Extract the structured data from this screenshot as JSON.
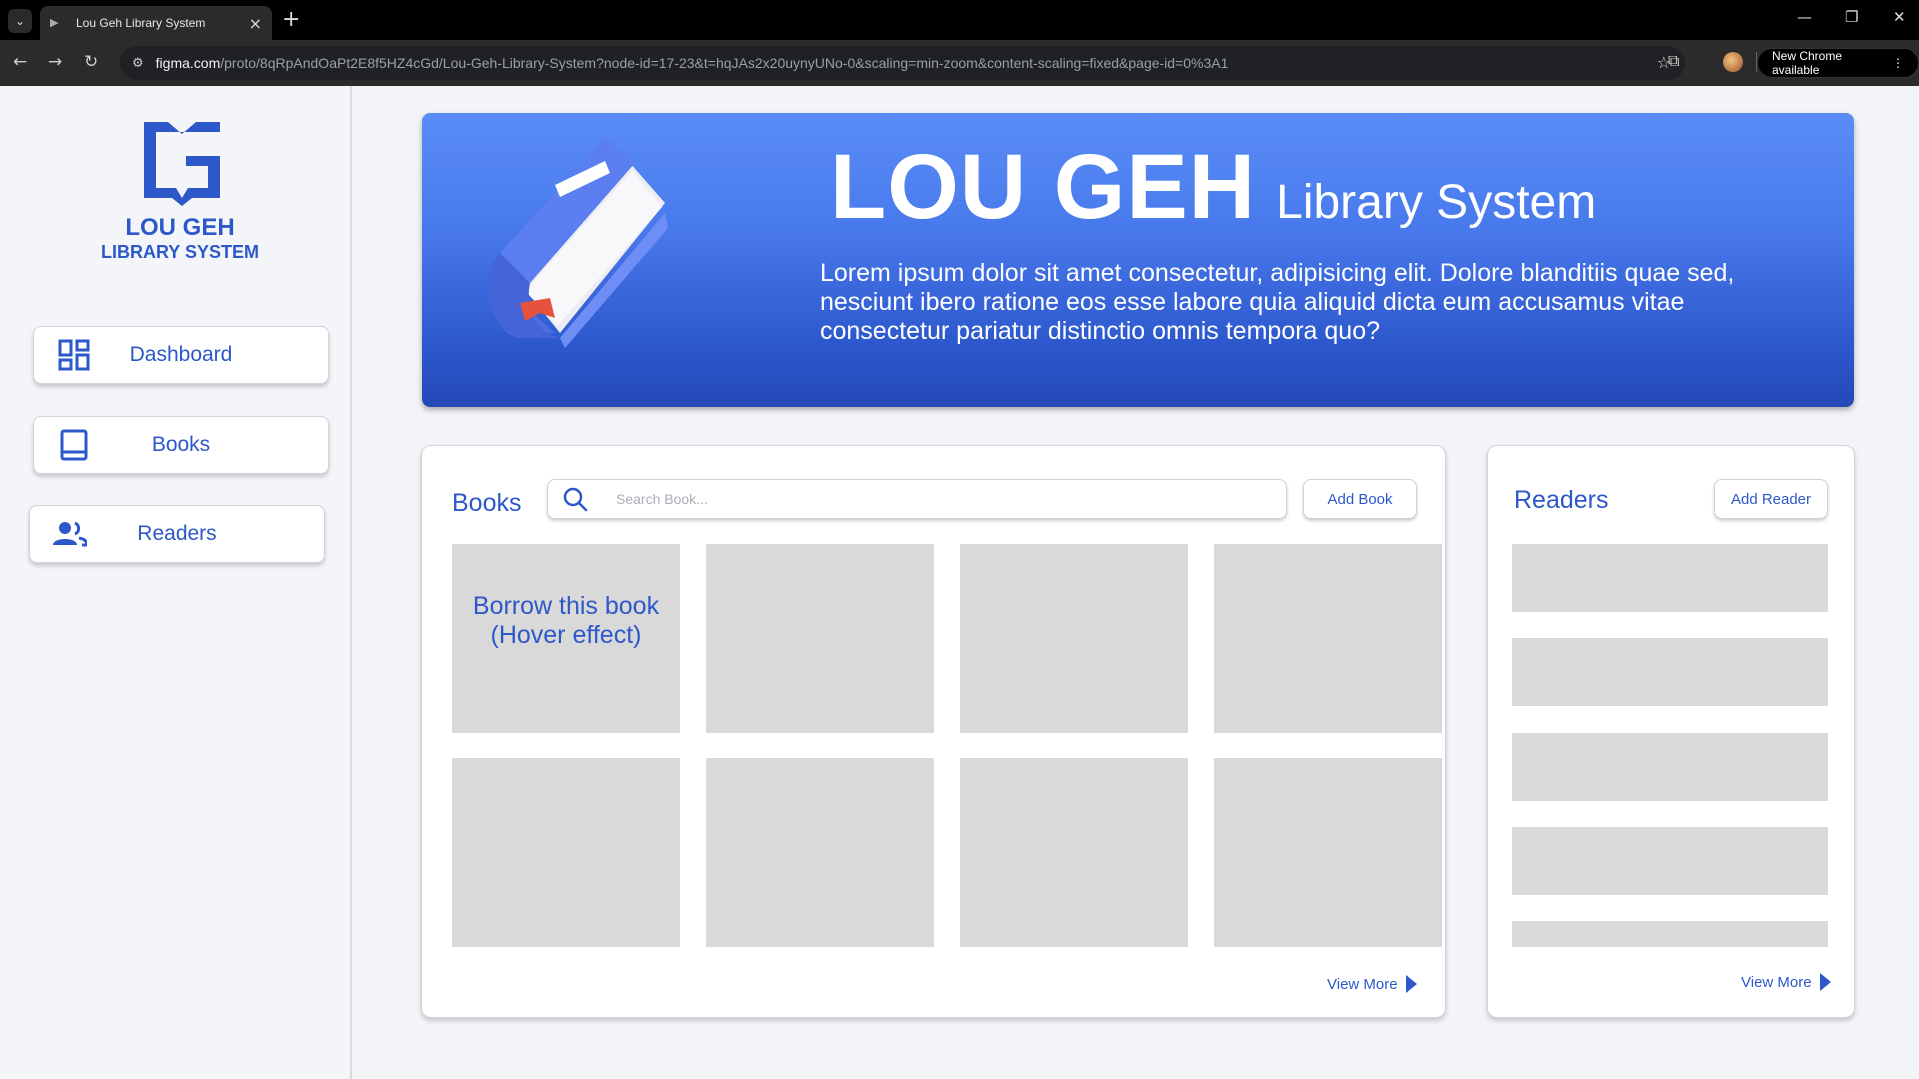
{
  "browser": {
    "tab_title": "Lou Geh Library System",
    "url_host": "figma.com",
    "url_path": "/proto/8qRpAndOaPt2E8f5HZ4cGd/Lou-Geh-Library-System?node-id=17-23&t=hqJAs2x20uynyUNo-0&scaling=min-zoom&content-scaling=fixed&page-id=0%3A1",
    "new_chrome_label": "New Chrome available"
  },
  "sidebar": {
    "logo_line1": "LOU GEH",
    "logo_line2": "LIBRARY SYSTEM",
    "items": [
      {
        "label": "Dashboard",
        "icon": "dashboard-icon"
      },
      {
        "label": "Books",
        "icon": "book-icon"
      },
      {
        "label": "Readers",
        "icon": "people-icon"
      }
    ]
  },
  "hero": {
    "title_main": "LOU GEH",
    "title_sub": "Library System",
    "description": "Lorem ipsum dolor sit amet consectetur, adipisicing elit. Dolore blanditiis quae sed, nesciunt ibero ratione eos esse labore quia aliquid dicta eum accusamus vitae consectetur pariatur distinctio omnis tempora quo?"
  },
  "books": {
    "title": "Books",
    "search_placeholder": "Search Book...",
    "add_label": "Add Book",
    "hover_text": "Borrow this book (Hover effect)",
    "view_more": "View More"
  },
  "readers": {
    "title": "Readers",
    "add_label": "Add Reader",
    "view_more": "View More"
  },
  "colors": {
    "accent": "#2d58c9",
    "placeholder_tile": "#d9d9d9",
    "hero_top": "#5b8df7",
    "hero_bottom": "#2549b6"
  }
}
